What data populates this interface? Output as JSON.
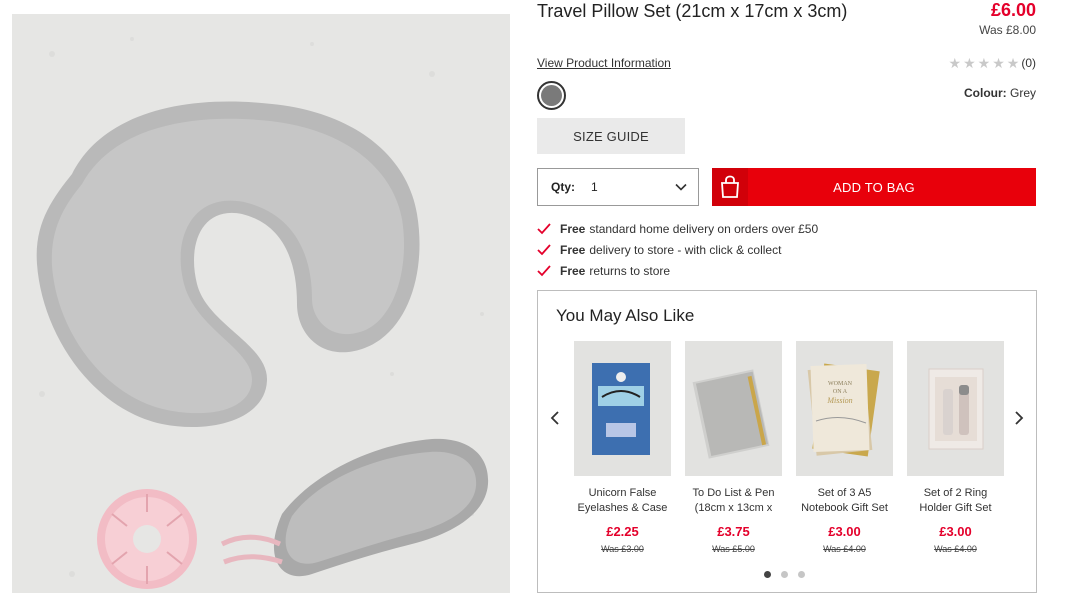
{
  "product": {
    "title": "Travel Pillow Set (21cm x 17cm x 3cm)",
    "price_now": "£6.00",
    "price_was": "Was £8.00",
    "view_info_label": "View Product Information",
    "rating_count": "(0)",
    "rating_value": 0,
    "rating_max": 5,
    "colour_label": "Colour:",
    "colour_value": "Grey",
    "swatch_color": "#7a7a7a",
    "size_guide_label": "SIZE GUIDE",
    "qty_label": "Qty:",
    "qty_value": "1",
    "add_to_bag_label": "ADD TO BAG",
    "accent_color": "#e8000b"
  },
  "benefits": [
    {
      "bold": "Free",
      "text": "standard home delivery on orders over £50"
    },
    {
      "bold": "Free",
      "text": "delivery to store - with click & collect"
    },
    {
      "bold": "Free",
      "text": "returns to store"
    }
  ],
  "ymal": {
    "title": "You May Also Like",
    "items": [
      {
        "name": "Unicorn False Eyelashes & Case",
        "price": "£2.25",
        "was": "Was £3.00"
      },
      {
        "name": "To Do List & Pen (18cm x 13cm x",
        "price": "£3.75",
        "was": "Was £5.00"
      },
      {
        "name": "Set of 3 A5 Notebook Gift Set",
        "price": "£3.00",
        "was": "Was £4.00"
      },
      {
        "name": "Set of 2 Ring Holder Gift Set",
        "price": "£3.00",
        "was": "Was £4.00"
      }
    ],
    "notebook_text": [
      "WOMAN",
      "ON A",
      "Mission"
    ],
    "dots": 3,
    "active_dot": 0
  },
  "icons": {
    "star": "star-icon",
    "chevron": "chevron-down-icon",
    "bag": "shopping-bag-icon",
    "check": "checkmark-icon",
    "prev": "chevron-left-icon",
    "next": "chevron-right-icon"
  }
}
